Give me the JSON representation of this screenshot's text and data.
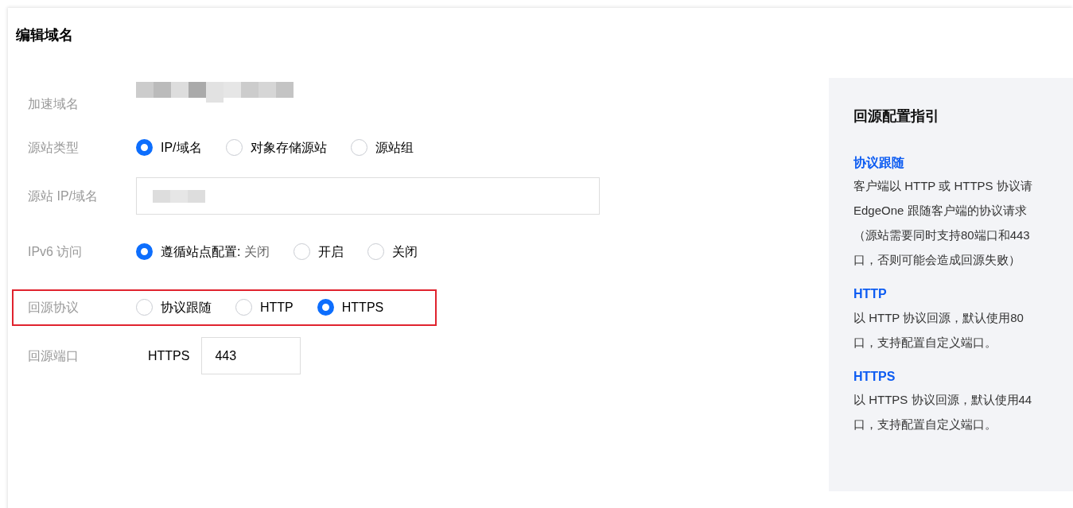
{
  "dialog": {
    "title": "编辑域名"
  },
  "form": {
    "rows": [
      {
        "kind": "static",
        "label": "加速域名"
      },
      {
        "kind": "radio",
        "label": "源站类型",
        "options": [
          {
            "label": "IP/域名",
            "selected": true
          },
          {
            "label": "对象存储源站",
            "selected": false
          },
          {
            "label": "源站组",
            "selected": false
          }
        ]
      },
      {
        "kind": "input",
        "label": "源站 IP/域名"
      },
      {
        "kind": "radio",
        "label": "IPv6 访问",
        "options": [
          {
            "label": "遵循站点配置:",
            "note": "关闭",
            "selected": true
          },
          {
            "label": "开启",
            "selected": false
          },
          {
            "label": "关闭",
            "selected": false
          }
        ]
      },
      {
        "kind": "radio",
        "label": "回源协议",
        "highlighted": true,
        "options": [
          {
            "label": "协议跟随",
            "selected": false
          },
          {
            "label": "HTTP",
            "selected": false
          },
          {
            "label": "HTTPS",
            "selected": true
          }
        ]
      },
      {
        "kind": "port",
        "label": "回源端口",
        "prefix": "HTTPS",
        "value": "443"
      }
    ]
  },
  "guide": {
    "title": "回源配置指引",
    "sections": [
      {
        "heading": "协议跟随",
        "lines": [
          "客户端以 HTTP 或 HTTPS 协议请",
          "EdgeOne 跟随客户端的协议请求",
          "（源站需要同时支持80端口和443",
          "口，否则可能会造成回源失败）"
        ]
      },
      {
        "heading": "HTTP",
        "lines": [
          "以 HTTP 协议回源，默认使用80",
          "口，支持配置自定义端口。"
        ]
      },
      {
        "heading": "HTTPS",
        "lines": [
          "以 HTTPS 协议回源，默认使用44",
          "口，支持配置自定义端口。"
        ]
      }
    ]
  }
}
